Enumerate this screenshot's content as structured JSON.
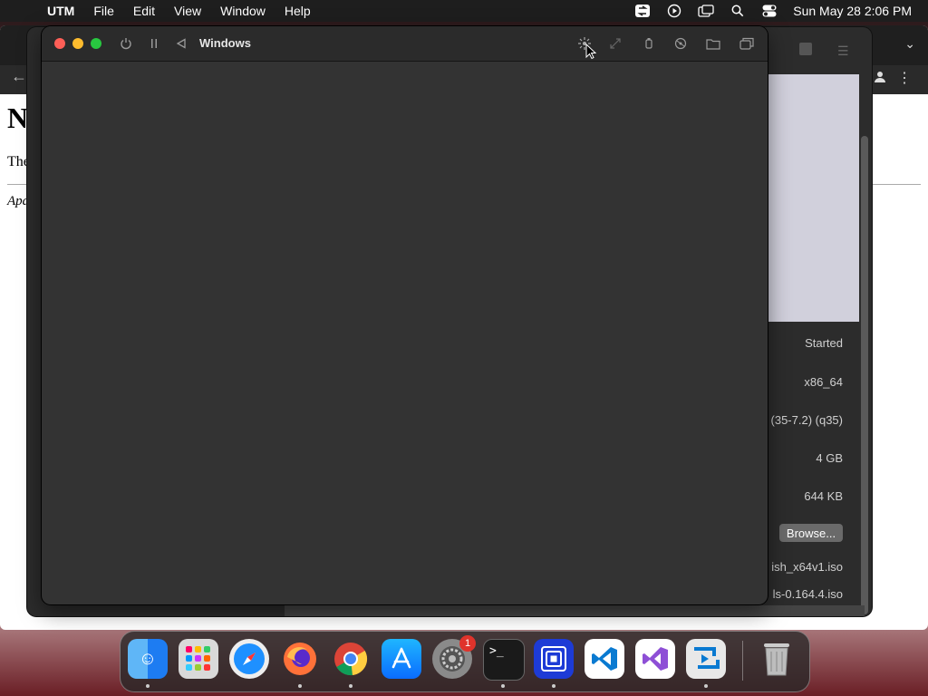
{
  "menubar": {
    "app_name": "UTM",
    "menus": [
      "File",
      "Edit",
      "View",
      "Window",
      "Help"
    ],
    "clock": "Sun May 28  2:06 PM"
  },
  "browser_page": {
    "heading": "No",
    "paragraph": "The re",
    "address": "Apach"
  },
  "vm_window": {
    "title": "Windows"
  },
  "vm_info": {
    "status": "Started",
    "architecture": "x86_64",
    "machine": "(35-7.2) (q35)",
    "memory": "4 GB",
    "size": "644 KB",
    "browse_label": "Browse...",
    "iso_1": "ish_x64v1.iso",
    "iso_2": "ls-0.164.4.iso"
  },
  "dock": {
    "items": [
      "Finder",
      "Launchpad",
      "Safari",
      "Firefox",
      "Chrome",
      "App Store",
      "System Settings",
      "Terminal",
      "UTM",
      "VS Code",
      "Visual Studio",
      "Remote Desktop",
      "Trash"
    ],
    "settings_badge": "1"
  }
}
